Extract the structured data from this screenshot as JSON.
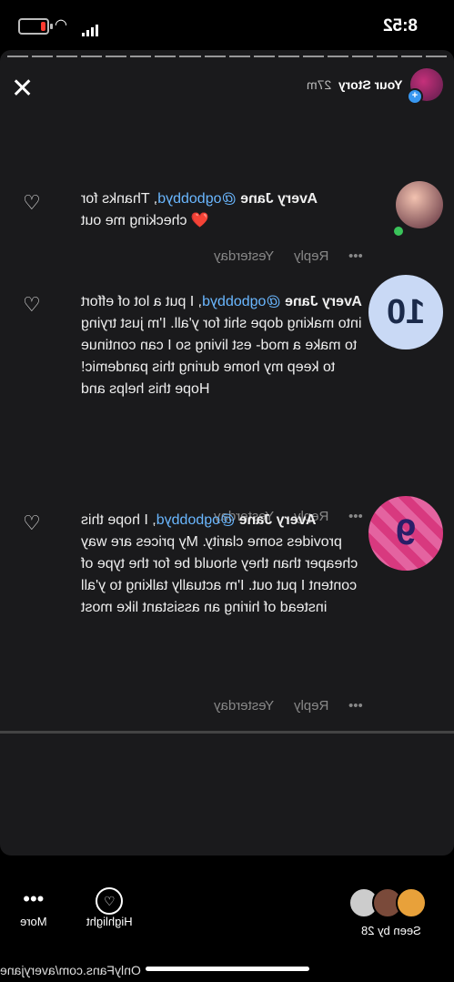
{
  "status_bar": {
    "time": "8:52"
  },
  "story_header": {
    "name": "Your Story",
    "time": "27m"
  },
  "comments": [
    {
      "author": "Avery Jane",
      "mention": "@ogbobbyd",
      "text": ", Thanks for checking me out",
      "emoji": "❤️",
      "time": "Yesterday",
      "reply": "Reply",
      "dots": "•••"
    },
    {
      "author": "Avery Jane",
      "mention": "@ogbobbyd",
      "text": ", I put a lot of effort into making dope shit for y'all. I'm just trying to make a mod- est living so I can continue to keep my home during this pandemic! Hope this helps and",
      "avatar_text": "10",
      "time": "Yesterday",
      "reply": "Reply",
      "dots": "•••"
    },
    {
      "author": "Avery Jane",
      "mention": "@ogbobbyd",
      "text": ", I hope this provides some clarity. My prices are way cheaper than they should be for the type of content I put out. I'm actually talking to y'all instead of hiring an assistant like most",
      "avatar_text": "9",
      "time": "Yesterday",
      "reply": "Reply",
      "dots": "•••"
    }
  ],
  "bottom_bar": {
    "more_label": "More",
    "highlight_label": "Highlight",
    "seen_label": "Seen by 28"
  },
  "watermark": "OnlyFans.com/averyjane",
  "icons": {
    "close": "close-icon",
    "heart": "heart-icon",
    "more": "more-icon",
    "highlight": "highlight-icon"
  }
}
